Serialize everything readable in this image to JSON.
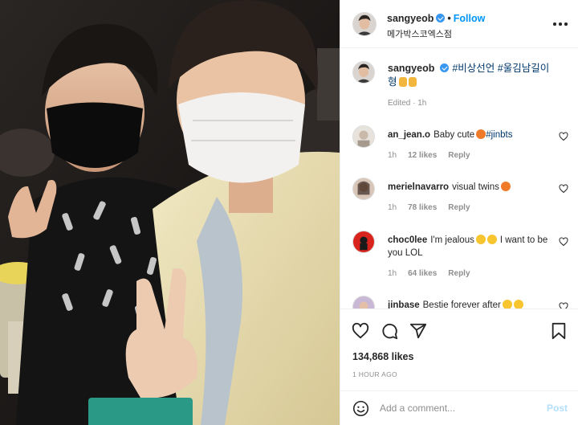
{
  "post": {
    "username": "sangyeob",
    "follow_label": "Follow",
    "separator": "•",
    "location": "메가박스코엑스점",
    "caption_user": "sangyeob",
    "caption_text": "#비상선언 #울김남길이 형",
    "caption_meta": "Edited · 1h",
    "likes": "134,868 likes",
    "time_ago": "1 HOUR AGO"
  },
  "comments": [
    {
      "user": "an_jean.o",
      "text": "Baby cute",
      "tag": "#jinbts",
      "time": "1h",
      "likes": "12 likes",
      "reply": "Reply"
    },
    {
      "user": "merielnavarro",
      "text": "visual twins",
      "time": "1h",
      "likes": "78 likes",
      "reply": "Reply"
    },
    {
      "user": "choc0lee",
      "text": "I'm jealous",
      "text2": "I want to be you LOL",
      "time": "1h",
      "likes": "64 likes",
      "reply": "Reply"
    },
    {
      "user": "jinbase",
      "text": "Bestie forever after"
    }
  ],
  "add_comment": {
    "placeholder": "Add a comment...",
    "post_label": "Post"
  },
  "icons": {
    "verified": "verified-badge-icon",
    "more": "more-options-icon",
    "heart": "heart-icon",
    "comment": "comment-icon",
    "share": "share-icon",
    "save": "bookmark-icon",
    "emoji": "emoji-icon"
  },
  "colors": {
    "accent": "#0095f6",
    "verified": "#3897f0",
    "post_disabled": "#b2dffc",
    "muted": "#8e8e8e"
  }
}
